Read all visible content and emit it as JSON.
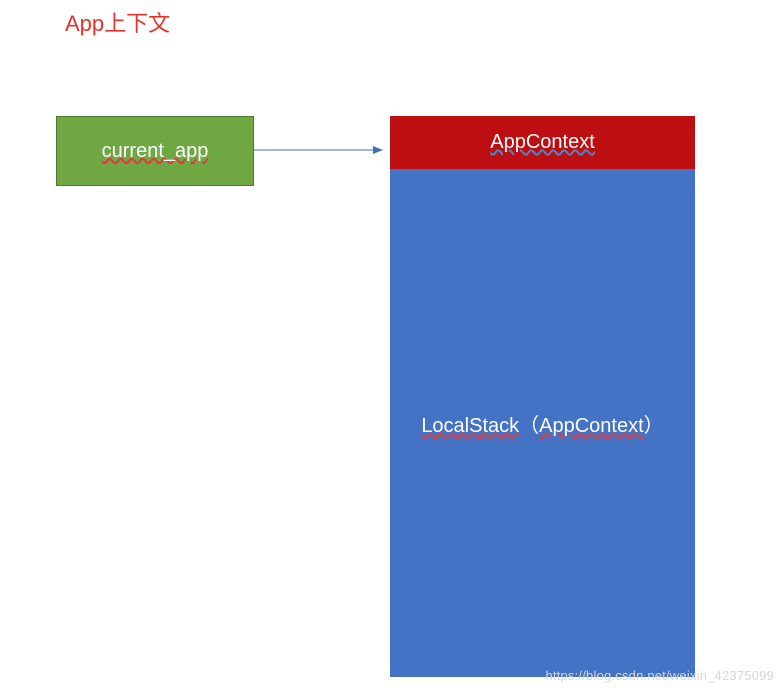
{
  "title": "App上下文",
  "greenBox": {
    "label": "current_app"
  },
  "redBox": {
    "label": "AppContext"
  },
  "blueBox": {
    "label_part1": "LocalStack",
    "label_paren_open": "（",
    "label_part2": "AppContext",
    "label_paren_close": "）"
  },
  "watermark": "https://blog.csdn.net/weixin_42375099",
  "colors": {
    "title": "#e6332a",
    "green": "#6fa843",
    "greenBorder": "#4e7730",
    "red": "#bd0f12",
    "blue": "#4472c4",
    "arrow": "#3e6fb5"
  }
}
